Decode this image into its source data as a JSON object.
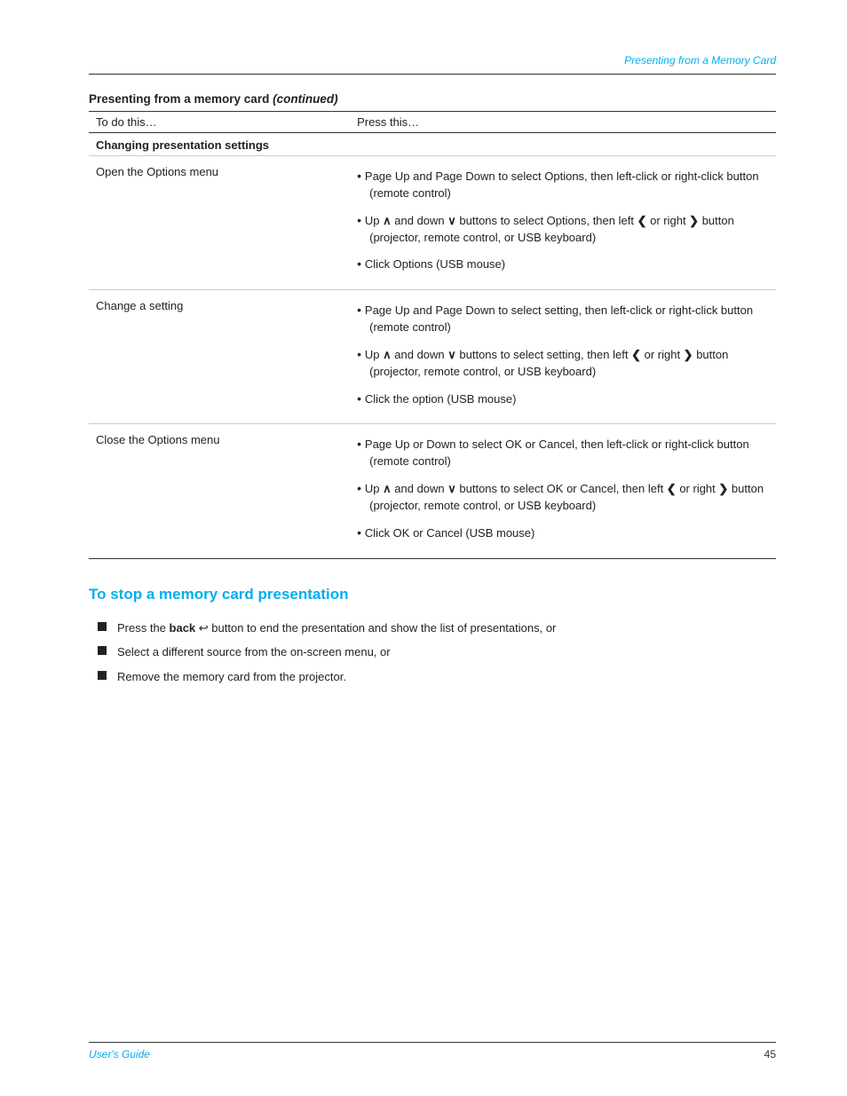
{
  "header": {
    "title": "Presenting from a Memory Card"
  },
  "section": {
    "heading_normal": "Presenting from a memory card ",
    "heading_italic": "(continued)"
  },
  "table": {
    "col1_header": "To do this…",
    "col2_header": "Press this…",
    "subsection_label": "Changing presentation settings",
    "rows": [
      {
        "action": "Open the Options menu",
        "items": [
          "Page Up and Page Down to select Options, then left-click or right-click button (remote control)",
          "Up ∧ and down ∨ buttons to select Options, then left ‹ or right › button (projector, remote control, or USB keyboard)",
          "Click Options (USB mouse)"
        ]
      },
      {
        "action": "Change a setting",
        "items": [
          "Page Up and Page Down to select setting, then left-click or right-click button (remote control)",
          "Up ∧ and down ∨ buttons to select setting, then left ‹ or right › button (projector, remote control, or USB keyboard)",
          "Click the option (USB mouse)"
        ]
      },
      {
        "action": "Close the Options menu",
        "items": [
          "Page Up or Down to select OK or Cancel, then left-click or right-click button (remote control)",
          "Up ∧ and down ∨ buttons to select OK or Cancel, then left ‹ or right › button (projector, remote control, or USB keyboard)",
          "Click OK or Cancel (USB mouse)"
        ],
        "last": true
      }
    ]
  },
  "stop_section": {
    "title": "To stop a memory card presentation",
    "items": [
      {
        "text_parts": [
          "Press the ",
          "back",
          " ↵ button to end the presentation and show the list of presentations, or"
        ],
        "bold_word": "back",
        "has_symbol": true
      },
      {
        "text_parts": [
          "Select a different source from the on-screen menu, or"
        ],
        "bold_word": null,
        "has_symbol": false
      },
      {
        "text_parts": [
          "Remove the memory card from the projector."
        ],
        "bold_word": null,
        "has_symbol": false
      }
    ]
  },
  "footer": {
    "left": "User's Guide",
    "right": "45"
  }
}
